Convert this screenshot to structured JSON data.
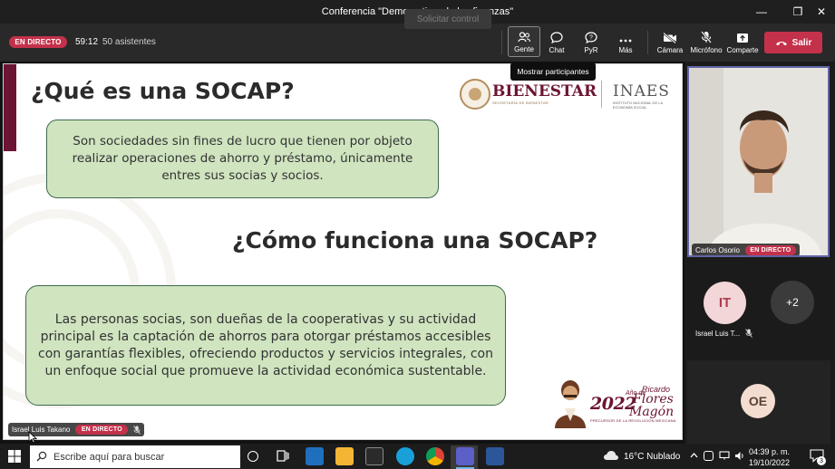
{
  "window": {
    "title": "Conferencia \"Democratizando las finanzas\"",
    "minimize_glyph": "—",
    "maximize_glyph": "❐",
    "close_glyph": "✕"
  },
  "meeting_bar": {
    "live_label": "EN DIRECTO",
    "timer": "59:12",
    "attendees": "50 asistentes",
    "request_control_label": "Solicitar control",
    "tools": [
      {
        "label": "Gente",
        "icon": "people-icon"
      },
      {
        "label": "Chat",
        "icon": "chat-icon"
      },
      {
        "label": "PyR",
        "icon": "qa-icon"
      },
      {
        "label": "Más",
        "icon": "more-icon"
      },
      {
        "label": "Cámara",
        "icon": "camera-off-icon"
      },
      {
        "label": "Micrófono",
        "icon": "mic-off-icon"
      },
      {
        "label": "Comparte",
        "icon": "share-icon"
      }
    ],
    "leave_label": "Salir",
    "tooltip": "Mostrar participantes"
  },
  "slide": {
    "title1": "¿Qué es una SOCAP?",
    "box1_lines": [
      "Son sociedades sin fines de lucro que tienen por objeto",
      "realizar operaciones de ahorro y préstamo, únicamente",
      "entres sus socias y socios."
    ],
    "title2": "¿Cómo funciona una SOCAP?",
    "box2_lines": [
      "Las personas socias, son dueñas de la cooperativas y su actividad",
      "principal es la captación de ahorros para otorgar préstamos accesibles",
      "con garantías flexibles, ofreciendo productos y servicios integrales, con",
      "un enfoque social que promueve la actividad económica sustentable."
    ],
    "logo_bienestar": "BIENESTAR",
    "logo_bienestar_sub": "SECRETARÍA DE BIENESTAR",
    "logo_inaes": "INAES",
    "logo_inaes_sub": "INSTITUTO NACIONAL DE LA ECONOMÍA SOCIAL",
    "year_logo_year": "2022",
    "year_logo_small": "Año de",
    "year_logo_name1": "Ricardo",
    "year_logo_name2": "Flores",
    "year_logo_name3": "Magón",
    "year_logo_tagline": "PRECURSOR DE LA REVOLUCIÓN MEXICANA"
  },
  "presenter_bar": {
    "name": "Israel Luis Takano",
    "live_label": "EN DIRECTO"
  },
  "participants": {
    "main_video": {
      "name": "Carlos Osorio",
      "live_label": "EN DIRECTO"
    },
    "tiles": [
      {
        "initials": "IT",
        "name": "Israel Luis T..."
      },
      {
        "initials": "+2"
      },
      {
        "initials": "OE"
      }
    ]
  },
  "taskbar": {
    "search_placeholder": "Escribe aquí para buscar",
    "weather": "16°C  Nublado",
    "time": "04:39 p. m.",
    "date": "19/10/2022",
    "notification_count": "3"
  },
  "colors": {
    "live_red": "#c4314b",
    "teams_purple": "#6264a7",
    "slide_maroon": "#6c1433",
    "bubble_green": "#cfe4bf"
  }
}
